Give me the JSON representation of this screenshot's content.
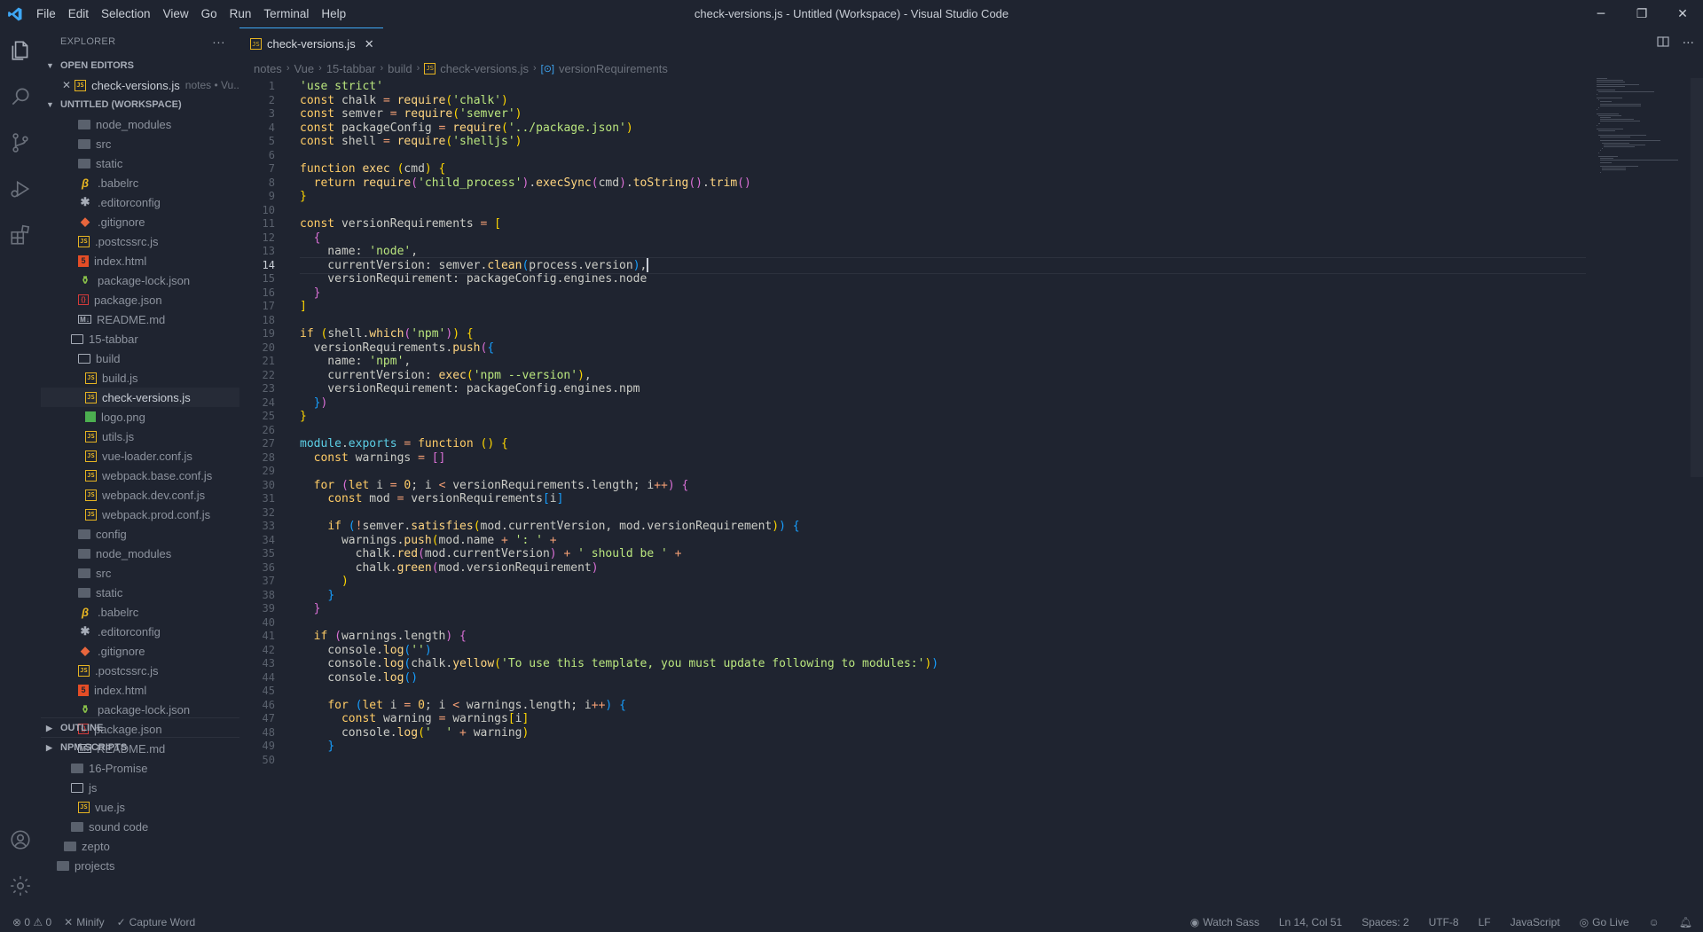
{
  "window": {
    "title": "check-versions.js - Untitled (Workspace) - Visual Studio Code",
    "menu": [
      "File",
      "Edit",
      "Selection",
      "View",
      "Go",
      "Run",
      "Terminal",
      "Help"
    ],
    "controls": {
      "minimize": "─",
      "restore": "❐",
      "close": "✕"
    }
  },
  "activity_bar": {
    "icons": [
      "files-icon",
      "search-icon",
      "source-control-icon",
      "run-debug-icon",
      "extensions-icon"
    ],
    "bottom_icons": [
      "account-icon",
      "settings-gear-icon"
    ]
  },
  "sidebar": {
    "title": "EXPLORER",
    "more": "···",
    "open_editors_label": "OPEN EDITORS",
    "open_editor": {
      "name": "check-versions.js",
      "description": "notes • Vu..."
    },
    "workspace_label": "UNTITLED (WORKSPACE)",
    "tree": [
      {
        "name": "node_modules",
        "icon": "folder",
        "depth": 2
      },
      {
        "name": "src",
        "icon": "folder",
        "depth": 2
      },
      {
        "name": "static",
        "icon": "folder",
        "depth": 2
      },
      {
        "name": ".babelrc",
        "icon": "babel",
        "depth": 2
      },
      {
        "name": ".editorconfig",
        "icon": "star",
        "depth": 2
      },
      {
        "name": ".gitignore",
        "icon": "git",
        "depth": 2
      },
      {
        "name": ".postcssrc.js",
        "icon": "js",
        "depth": 2
      },
      {
        "name": "index.html",
        "icon": "html",
        "depth": 2
      },
      {
        "name": "package-lock.json",
        "icon": "npm",
        "depth": 2
      },
      {
        "name": "package.json",
        "icon": "json",
        "depth": 2
      },
      {
        "name": "README.md",
        "icon": "md",
        "depth": 2
      },
      {
        "name": "15-tabbar",
        "icon": "folder-open",
        "depth": 1
      },
      {
        "name": "build",
        "icon": "folder-open",
        "depth": 2
      },
      {
        "name": "build.js",
        "icon": "js",
        "depth": 3
      },
      {
        "name": "check-versions.js",
        "icon": "js",
        "depth": 3,
        "selected": true
      },
      {
        "name": "logo.png",
        "icon": "png",
        "depth": 3
      },
      {
        "name": "utils.js",
        "icon": "js",
        "depth": 3
      },
      {
        "name": "vue-loader.conf.js",
        "icon": "js",
        "depth": 3
      },
      {
        "name": "webpack.base.conf.js",
        "icon": "js",
        "depth": 3
      },
      {
        "name": "webpack.dev.conf.js",
        "icon": "js",
        "depth": 3
      },
      {
        "name": "webpack.prod.conf.js",
        "icon": "js",
        "depth": 3
      },
      {
        "name": "config",
        "icon": "folder",
        "depth": 2
      },
      {
        "name": "node_modules",
        "icon": "folder",
        "depth": 2
      },
      {
        "name": "src",
        "icon": "folder",
        "depth": 2
      },
      {
        "name": "static",
        "icon": "folder",
        "depth": 2
      },
      {
        "name": ".babelrc",
        "icon": "babel",
        "depth": 2
      },
      {
        "name": ".editorconfig",
        "icon": "star",
        "depth": 2
      },
      {
        "name": ".gitignore",
        "icon": "git",
        "depth": 2
      },
      {
        "name": ".postcssrc.js",
        "icon": "js",
        "depth": 2
      },
      {
        "name": "index.html",
        "icon": "html",
        "depth": 2
      },
      {
        "name": "package-lock.json",
        "icon": "npm",
        "depth": 2
      },
      {
        "name": "package.json",
        "icon": "json",
        "depth": 2
      },
      {
        "name": "README.md",
        "icon": "md",
        "depth": 2
      },
      {
        "name": "16-Promise",
        "icon": "folder",
        "depth": 1
      },
      {
        "name": "js",
        "icon": "folder-open",
        "depth": 1
      },
      {
        "name": "vue.js",
        "icon": "js",
        "depth": 2
      },
      {
        "name": "sound code",
        "icon": "folder",
        "depth": 1
      },
      {
        "name": "zepto",
        "icon": "folder",
        "depth": 0
      },
      {
        "name": "projects",
        "icon": "folder",
        "depth": -1
      }
    ],
    "outline_label": "OUTLINE",
    "npm_scripts_label": "NPM SCRIPTS"
  },
  "editor": {
    "tab": {
      "label": "check-versions.js",
      "icon_text": "JS"
    },
    "breadcrumb": [
      "notes",
      "Vue",
      "15-tabbar",
      "build",
      "check-versions.js",
      "versionRequirements"
    ],
    "active_line": 14,
    "lines": [
      [
        [
          "t-str",
          "'use strict'"
        ]
      ],
      [
        [
          "t-kw",
          "const "
        ],
        [
          "t-plain",
          "chalk "
        ],
        [
          "t-op",
          "= "
        ],
        [
          "t-fn",
          "require"
        ],
        [
          "t-b1",
          "("
        ],
        [
          "t-str",
          "'chalk'"
        ],
        [
          "t-b1",
          ")"
        ]
      ],
      [
        [
          "t-kw",
          "const "
        ],
        [
          "t-plain",
          "semver "
        ],
        [
          "t-op",
          "= "
        ],
        [
          "t-fn",
          "require"
        ],
        [
          "t-b1",
          "("
        ],
        [
          "t-str",
          "'semver'"
        ],
        [
          "t-b1",
          ")"
        ]
      ],
      [
        [
          "t-kw",
          "const "
        ],
        [
          "t-plain",
          "packageConfig "
        ],
        [
          "t-op",
          "= "
        ],
        [
          "t-fn",
          "require"
        ],
        [
          "t-b1",
          "("
        ],
        [
          "t-str",
          "'../package.json'"
        ],
        [
          "t-b1",
          ")"
        ]
      ],
      [
        [
          "t-kw",
          "const "
        ],
        [
          "t-plain",
          "shell "
        ],
        [
          "t-op",
          "= "
        ],
        [
          "t-fn",
          "require"
        ],
        [
          "t-b1",
          "("
        ],
        [
          "t-str",
          "'shelljs'"
        ],
        [
          "t-b1",
          ")"
        ]
      ],
      [],
      [
        [
          "t-kw",
          "function "
        ],
        [
          "t-fn",
          "exec "
        ],
        [
          "t-b1",
          "("
        ],
        [
          "t-plain",
          "cmd"
        ],
        [
          "t-b1",
          ") {"
        ]
      ],
      [
        [
          "t-plain",
          "  "
        ],
        [
          "t-kw",
          "return "
        ],
        [
          "t-fn",
          "require"
        ],
        [
          "t-b2",
          "("
        ],
        [
          "t-str",
          "'child_process'"
        ],
        [
          "t-b2",
          ")"
        ],
        [
          "t-plain",
          "."
        ],
        [
          "t-fn",
          "execSync"
        ],
        [
          "t-b2",
          "("
        ],
        [
          "t-plain",
          "cmd"
        ],
        [
          "t-b2",
          ")"
        ],
        [
          "t-plain",
          "."
        ],
        [
          "t-fn",
          "toString"
        ],
        [
          "t-b2",
          "()"
        ],
        [
          "t-plain",
          "."
        ],
        [
          "t-fn",
          "trim"
        ],
        [
          "t-b2",
          "()"
        ]
      ],
      [
        [
          "t-b1",
          "}"
        ]
      ],
      [],
      [
        [
          "t-kw",
          "const "
        ],
        [
          "t-plain",
          "versionRequirements "
        ],
        [
          "t-op",
          "= "
        ],
        [
          "t-b1",
          "["
        ]
      ],
      [
        [
          "t-plain",
          "  "
        ],
        [
          "t-b2",
          "{"
        ]
      ],
      [
        [
          "t-plain",
          "    name: "
        ],
        [
          "t-str",
          "'node'"
        ],
        [
          "t-plain",
          ","
        ]
      ],
      [
        [
          "t-plain",
          "    currentVersion: semver."
        ],
        [
          "t-fn",
          "clean"
        ],
        [
          "t-b3",
          "("
        ],
        [
          "t-plain",
          "process.version"
        ],
        [
          "t-b3",
          ")"
        ],
        [
          "t-plain",
          ","
        ],
        [
          "cursor",
          ""
        ]
      ],
      [
        [
          "t-plain",
          "    versionRequirement: packageConfig.engines.node"
        ]
      ],
      [
        [
          "t-plain",
          "  "
        ],
        [
          "t-b2",
          "}"
        ]
      ],
      [
        [
          "t-b1",
          "]"
        ]
      ],
      [],
      [
        [
          "t-kw",
          "if "
        ],
        [
          "t-b1",
          "("
        ],
        [
          "t-plain",
          "shell."
        ],
        [
          "t-fn",
          "which"
        ],
        [
          "t-b2",
          "("
        ],
        [
          "t-str",
          "'npm'"
        ],
        [
          "t-b2",
          ")"
        ],
        [
          "t-b1",
          ")"
        ],
        [
          "t-plain",
          " "
        ],
        [
          "t-b1",
          "{"
        ]
      ],
      [
        [
          "t-plain",
          "  versionRequirements."
        ],
        [
          "t-fn",
          "push"
        ],
        [
          "t-b2",
          "("
        ],
        [
          "t-b3",
          "{"
        ]
      ],
      [
        [
          "t-plain",
          "    name: "
        ],
        [
          "t-str",
          "'npm'"
        ],
        [
          "t-plain",
          ","
        ]
      ],
      [
        [
          "t-plain",
          "    currentVersion: "
        ],
        [
          "t-fn",
          "exec"
        ],
        [
          "t-b1",
          "("
        ],
        [
          "t-str",
          "'npm --version'"
        ],
        [
          "t-b1",
          ")"
        ],
        [
          "t-plain",
          ","
        ]
      ],
      [
        [
          "t-plain",
          "    versionRequirement: packageConfig.engines.npm"
        ]
      ],
      [
        [
          "t-plain",
          "  "
        ],
        [
          "t-b3",
          "}"
        ],
        [
          "t-b2",
          ")"
        ]
      ],
      [
        [
          "t-b1",
          "}"
        ]
      ],
      [],
      [
        [
          "t-builtin",
          "module"
        ],
        [
          "t-plain",
          "."
        ],
        [
          "t-builtin",
          "exports "
        ],
        [
          "t-op",
          "= "
        ],
        [
          "t-kw",
          "function "
        ],
        [
          "t-b1",
          "() {"
        ]
      ],
      [
        [
          "t-plain",
          "  "
        ],
        [
          "t-kw",
          "const "
        ],
        [
          "t-plain",
          "warnings "
        ],
        [
          "t-op",
          "= "
        ],
        [
          "t-b2",
          "[]"
        ]
      ],
      [],
      [
        [
          "t-plain",
          "  "
        ],
        [
          "t-kw",
          "for "
        ],
        [
          "t-b2",
          "("
        ],
        [
          "t-kw",
          "let "
        ],
        [
          "t-plain",
          "i "
        ],
        [
          "t-op",
          "= "
        ],
        [
          "t-num",
          "0"
        ],
        [
          "t-plain",
          "; i "
        ],
        [
          "t-op",
          "< "
        ],
        [
          "t-plain",
          "versionRequirements.length; i"
        ],
        [
          "t-op",
          "++"
        ],
        [
          "t-b2",
          ")"
        ],
        [
          "t-plain",
          " "
        ],
        [
          "t-b2",
          "{"
        ]
      ],
      [
        [
          "t-plain",
          "    "
        ],
        [
          "t-kw",
          "const "
        ],
        [
          "t-plain",
          "mod "
        ],
        [
          "t-op",
          "= "
        ],
        [
          "t-plain",
          "versionRequirements"
        ],
        [
          "t-b3",
          "["
        ],
        [
          "t-plain",
          "i"
        ],
        [
          "t-b3",
          "]"
        ]
      ],
      [],
      [
        [
          "t-plain",
          "    "
        ],
        [
          "t-kw",
          "if "
        ],
        [
          "t-b3",
          "("
        ],
        [
          "t-op",
          "!"
        ],
        [
          "t-plain",
          "semver."
        ],
        [
          "t-fn",
          "satisfies"
        ],
        [
          "t-b1",
          "("
        ],
        [
          "t-plain",
          "mod.currentVersion, mod.versionRequirement"
        ],
        [
          "t-b1",
          ")"
        ],
        [
          "t-b3",
          ")"
        ],
        [
          "t-plain",
          " "
        ],
        [
          "t-b3",
          "{"
        ]
      ],
      [
        [
          "t-plain",
          "      warnings."
        ],
        [
          "t-fn",
          "push"
        ],
        [
          "t-b1",
          "("
        ],
        [
          "t-plain",
          "mod.name "
        ],
        [
          "t-op",
          "+ "
        ],
        [
          "t-str",
          "': ' "
        ],
        [
          "t-op",
          "+"
        ]
      ],
      [
        [
          "t-plain",
          "        chalk."
        ],
        [
          "t-fn",
          "red"
        ],
        [
          "t-b2",
          "("
        ],
        [
          "t-plain",
          "mod.currentVersion"
        ],
        [
          "t-b2",
          ")"
        ],
        [
          "t-plain",
          " "
        ],
        [
          "t-op",
          "+ "
        ],
        [
          "t-str",
          "' should be ' "
        ],
        [
          "t-op",
          "+"
        ]
      ],
      [
        [
          "t-plain",
          "        chalk."
        ],
        [
          "t-fn",
          "green"
        ],
        [
          "t-b2",
          "("
        ],
        [
          "t-plain",
          "mod.versionRequirement"
        ],
        [
          "t-b2",
          ")"
        ]
      ],
      [
        [
          "t-plain",
          "      "
        ],
        [
          "t-b1",
          ")"
        ]
      ],
      [
        [
          "t-plain",
          "    "
        ],
        [
          "t-b3",
          "}"
        ]
      ],
      [
        [
          "t-plain",
          "  "
        ],
        [
          "t-b2",
          "}"
        ]
      ],
      [],
      [
        [
          "t-plain",
          "  "
        ],
        [
          "t-kw",
          "if "
        ],
        [
          "t-b2",
          "("
        ],
        [
          "t-plain",
          "warnings.length"
        ],
        [
          "t-b2",
          ")"
        ],
        [
          "t-plain",
          " "
        ],
        [
          "t-b2",
          "{"
        ]
      ],
      [
        [
          "t-plain",
          "    console."
        ],
        [
          "t-fn",
          "log"
        ],
        [
          "t-b3",
          "("
        ],
        [
          "t-str",
          "''"
        ],
        [
          "t-b3",
          ")"
        ]
      ],
      [
        [
          "t-plain",
          "    console."
        ],
        [
          "t-fn",
          "log"
        ],
        [
          "t-b3",
          "("
        ],
        [
          "t-plain",
          "chalk."
        ],
        [
          "t-fn",
          "yellow"
        ],
        [
          "t-b1",
          "("
        ],
        [
          "t-str",
          "'To use this template, you must update following to modules:'"
        ],
        [
          "t-b1",
          ")"
        ],
        [
          "t-b3",
          ")"
        ]
      ],
      [
        [
          "t-plain",
          "    console."
        ],
        [
          "t-fn",
          "log"
        ],
        [
          "t-b3",
          "()"
        ]
      ],
      [],
      [
        [
          "t-plain",
          "    "
        ],
        [
          "t-kw",
          "for "
        ],
        [
          "t-b3",
          "("
        ],
        [
          "t-kw",
          "let "
        ],
        [
          "t-plain",
          "i "
        ],
        [
          "t-op",
          "= "
        ],
        [
          "t-num",
          "0"
        ],
        [
          "t-plain",
          "; i "
        ],
        [
          "t-op",
          "< "
        ],
        [
          "t-plain",
          "warnings.length; i"
        ],
        [
          "t-op",
          "++"
        ],
        [
          "t-b3",
          ")"
        ],
        [
          "t-plain",
          " "
        ],
        [
          "t-b3",
          "{"
        ]
      ],
      [
        [
          "t-plain",
          "      "
        ],
        [
          "t-kw",
          "const "
        ],
        [
          "t-plain",
          "warning "
        ],
        [
          "t-op",
          "= "
        ],
        [
          "t-plain",
          "warnings"
        ],
        [
          "t-b1",
          "["
        ],
        [
          "t-plain",
          "i"
        ],
        [
          "t-b1",
          "]"
        ]
      ],
      [
        [
          "t-plain",
          "      console."
        ],
        [
          "t-fn",
          "log"
        ],
        [
          "t-b1",
          "("
        ],
        [
          "t-str",
          "'  ' "
        ],
        [
          "t-op",
          "+ "
        ],
        [
          "t-plain",
          "warning"
        ],
        [
          "t-b1",
          ")"
        ]
      ],
      [
        [
          "t-plain",
          "    "
        ],
        [
          "t-b3",
          "}"
        ]
      ],
      [
        [
          "t-plain",
          ""
        ]
      ]
    ]
  },
  "statusbar": {
    "problems": "⊗ 0 ⚠ 0",
    "minify": "Minify",
    "capture": "Capture Word",
    "watch_sass": "Watch Sass",
    "position": "Ln 14, Col 51",
    "spaces": "Spaces: 2",
    "encoding": "UTF-8",
    "eol": "LF",
    "language": "JavaScript",
    "go_live": "Go Live"
  },
  "colors": {
    "accent": "#3ea7f5",
    "background": "#1f2430",
    "string": "#bae67e",
    "keyword": "#ffcc66"
  }
}
